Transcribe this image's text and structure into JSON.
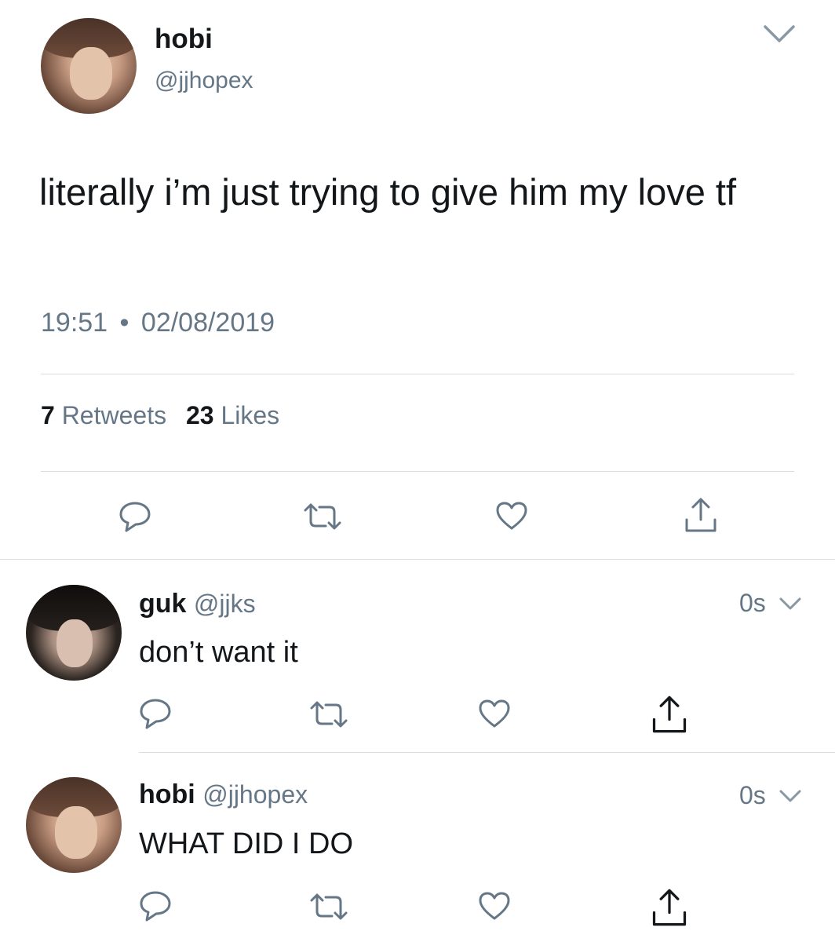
{
  "main_tweet": {
    "name": "hobi",
    "handle": "@jjhopex",
    "text": "literally i’m just trying to give him my love tf",
    "time": "19:51",
    "separator": "•",
    "date": "02/08/2019",
    "retweets_count": "7",
    "retweets_label": "Retweets",
    "likes_count": "23",
    "likes_label": "Likes"
  },
  "replies": [
    {
      "name": "guk",
      "handle": "@jjks",
      "time": "0s",
      "text": "don’t want it"
    },
    {
      "name": "hobi",
      "handle": "@jjhopex",
      "time": "0s",
      "text": "WHAT DID I DO"
    }
  ],
  "icons": [
    "reply-icon",
    "retweet-icon",
    "like-icon",
    "share-icon",
    "chevron-down-icon"
  ],
  "colors": {
    "text": "#14171a",
    "secondary": "#657786",
    "icon": "#657786",
    "divider": "#d8dde1"
  }
}
